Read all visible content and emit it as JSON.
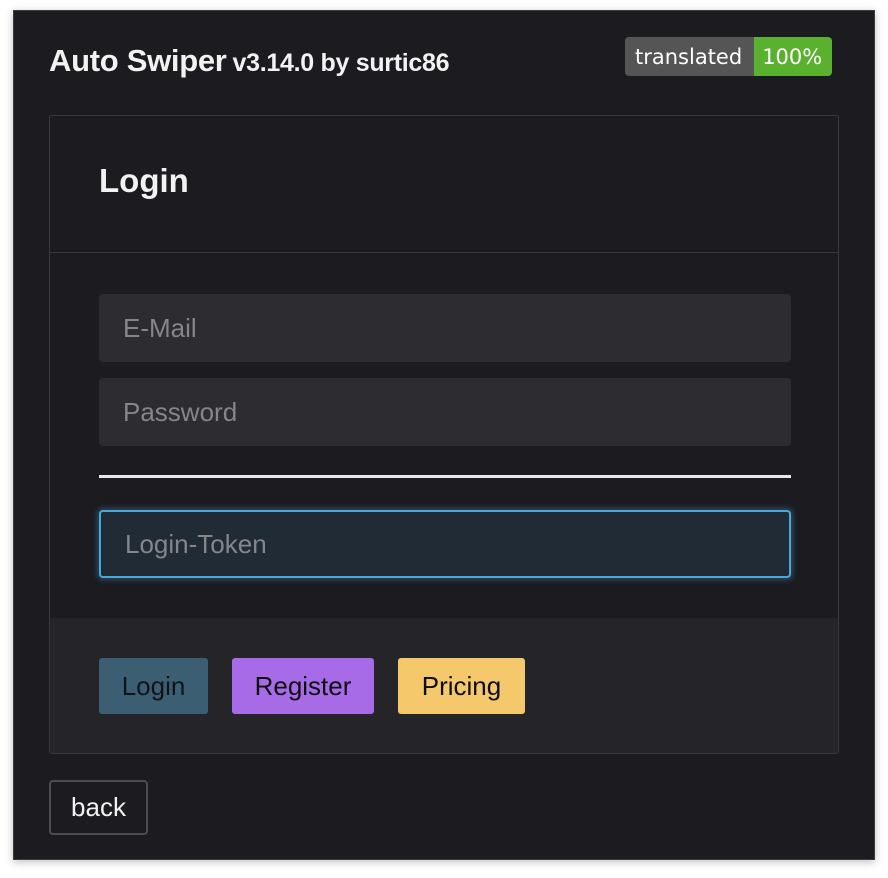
{
  "header": {
    "app_name": "Auto Swiper",
    "version_text": "v3.14.0 by surtic86",
    "badge": {
      "label": "translated",
      "value": "100%",
      "label_color": "#555555",
      "value_color": "#5ab12f"
    }
  },
  "login_card": {
    "title": "Login",
    "email": {
      "value": "",
      "placeholder": "E-Mail"
    },
    "password": {
      "value": "",
      "placeholder": "Password"
    },
    "token": {
      "value": "",
      "placeholder": "Login-Token"
    },
    "buttons": {
      "login": "Login",
      "register": "Register",
      "pricing": "Pricing"
    }
  },
  "footer": {
    "back_label": "back"
  },
  "colors": {
    "background": "#1b1b20",
    "accent": "#4aa8d8",
    "login_button": "#3c5e72",
    "register_button": "#a86be8",
    "pricing_button": "#f4c86b"
  }
}
